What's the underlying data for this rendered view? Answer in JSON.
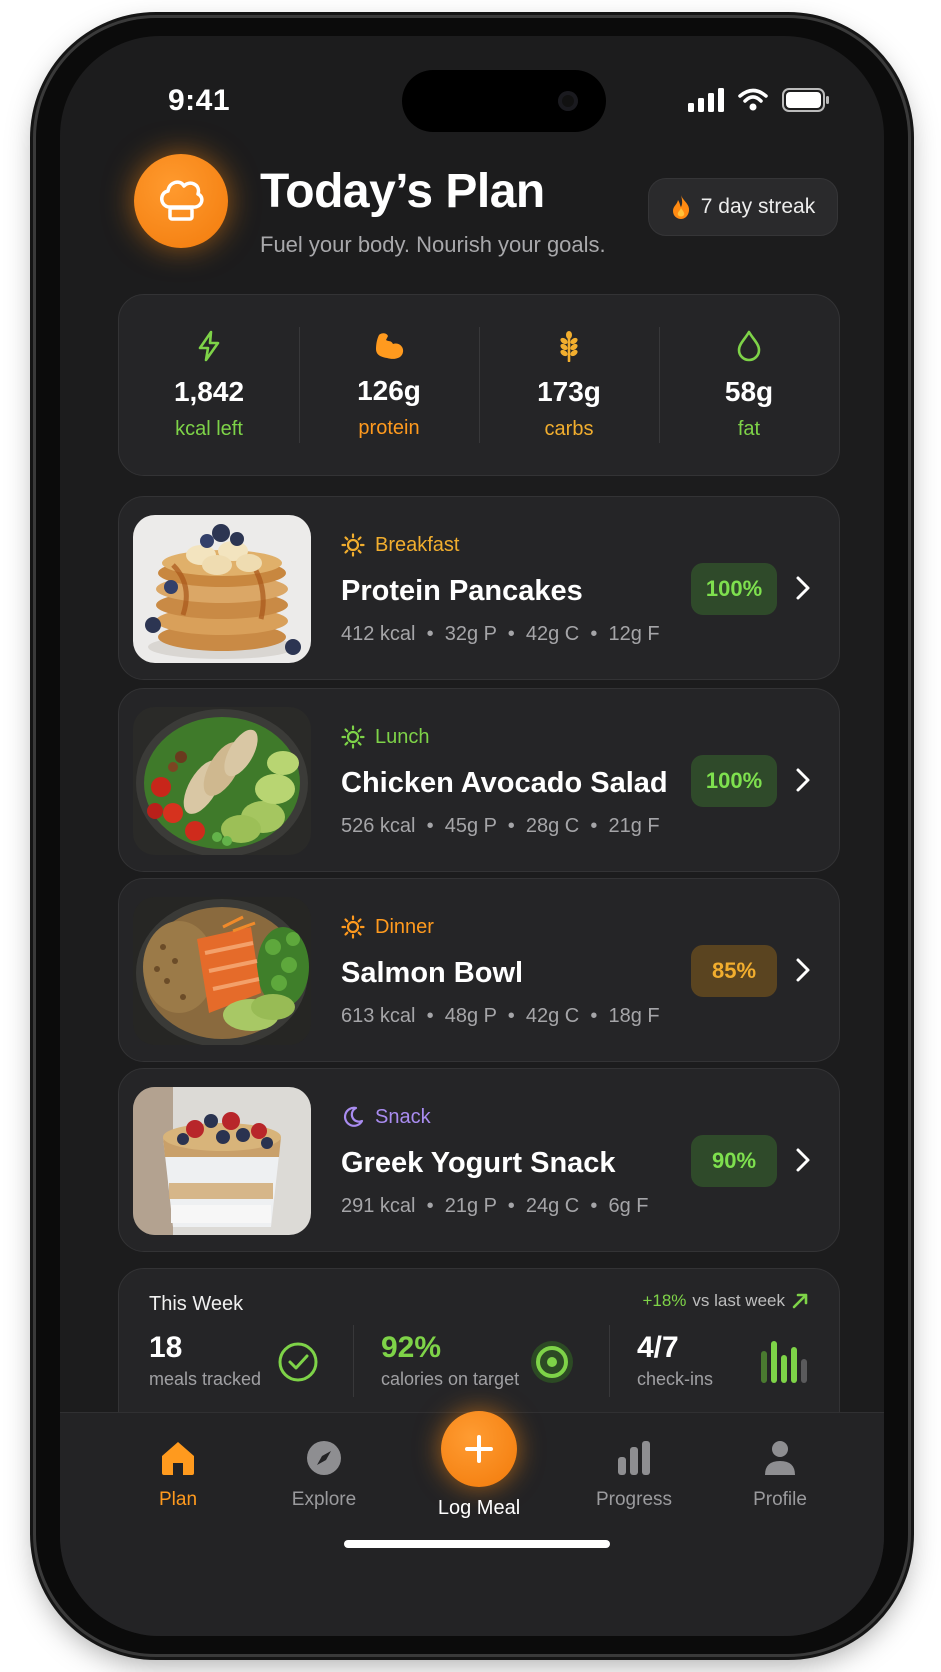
{
  "status": {
    "time": "9:41"
  },
  "header": {
    "title": "Today’s Plan",
    "subtitle": "Fuel your body. Nourish your goals.",
    "streak": "7 day streak",
    "logo_icon": "chef-hat-icon"
  },
  "stats": [
    {
      "value": "1,842",
      "label": "kcal left",
      "icon": "bolt-icon",
      "color": "#7ed348"
    },
    {
      "value": "126g",
      "label": "protein",
      "icon": "muscle-icon",
      "color": "#ff9a1e"
    },
    {
      "value": "173g",
      "label": "carbs",
      "icon": "wheat-icon",
      "color": "#f2ae2e"
    },
    {
      "value": "58g",
      "label": "fat",
      "icon": "drop-icon",
      "color": "#7ed348"
    }
  ],
  "meals": [
    {
      "category": "Breakfast",
      "name": "Protein Pancakes",
      "kcal": "412 kcal",
      "p": "32g P",
      "c": "42g C",
      "f": "12g F",
      "pct": "100%",
      "category_color": "#f2ae2e",
      "pct_style": "green"
    },
    {
      "category": "Lunch",
      "name": "Chicken Avocado Salad",
      "kcal": "526 kcal",
      "p": "45g P",
      "c": "28g C",
      "f": "21g F",
      "pct": "100%",
      "category_color": "#7ed348",
      "pct_style": "green"
    },
    {
      "category": "Dinner",
      "name": "Salmon Bowl",
      "kcal": "613 kcal",
      "p": "48g P",
      "c": "42g C",
      "f": "18g F",
      "pct": "85%",
      "category_color": "#ff9a1e",
      "pct_style": "amber"
    },
    {
      "category": "Snack",
      "name": "Greek Yogurt Snack",
      "kcal": "291 kcal",
      "p": "21g P",
      "c": "24g C",
      "f": "6g F",
      "pct": "90%",
      "category_color": "#a98cf0",
      "pct_style": "green"
    }
  ],
  "week": {
    "title": "This Week",
    "delta_value": "+18%",
    "delta_text": "vs last week",
    "meals": {
      "value": "18",
      "label": "meals tracked"
    },
    "calories": {
      "value": "92%",
      "label": "calories on target"
    },
    "checkins": {
      "value": "4/7",
      "label": "check-ins"
    }
  },
  "tabs": {
    "plan": "Plan",
    "explore": "Explore",
    "log": "Log Meal",
    "progress": "Progress",
    "profile": "Profile"
  },
  "colors": {
    "accent": "#ff9a1e",
    "green": "#7ed348",
    "bg": "#1c1c1d",
    "card": "#252527"
  }
}
